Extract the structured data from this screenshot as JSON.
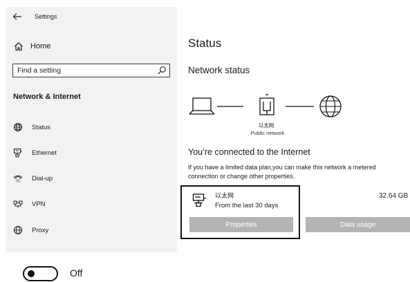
{
  "window": {
    "title": "Settings"
  },
  "sidebar": {
    "home_label": "Home",
    "search_placeholder": "Find a setting",
    "section_title": "Network & Internet",
    "items": [
      {
        "label": "Status",
        "icon": "globe-icon"
      },
      {
        "label": "Ethernet",
        "icon": "ethernet-icon"
      },
      {
        "label": "Dial-up",
        "icon": "phone-icon"
      },
      {
        "label": "VPN",
        "icon": "vpn-icon"
      },
      {
        "label": "Proxy",
        "icon": "globe-icon"
      }
    ]
  },
  "main": {
    "heading": "Status",
    "subheading": "Network status",
    "network": {
      "name": "以太网",
      "type": "Public network"
    },
    "connected_text": "You’re  connected to the Internet",
    "description": "If you have a limited data plan,you can make this network a metered connection or change other properties.",
    "adapter": {
      "name": "以太网",
      "range": "From the last 30 days",
      "usage": "32.64 GB"
    },
    "buttons": {
      "properties": "Properties",
      "data_usage": "Data usage"
    }
  },
  "toggle": {
    "state_label": "Off",
    "on": false
  },
  "colors": {
    "sidebar_bg": "#f2f2f2",
    "button_bg": "#b3b3b3",
    "button_text": "#ffffff",
    "highlight_border": "#111111"
  }
}
